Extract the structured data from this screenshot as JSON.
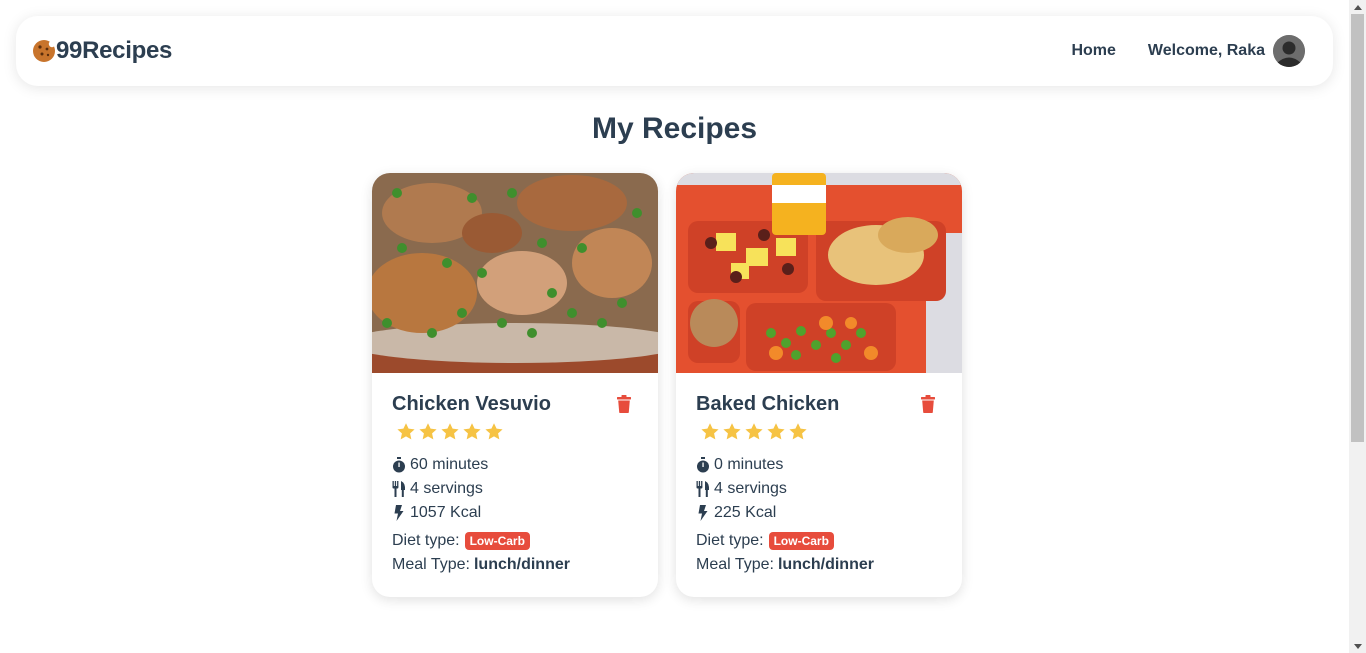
{
  "brand": {
    "name": "99Recipes",
    "icon": "cookie-icon"
  },
  "nav": {
    "home": "Home",
    "welcome": "Welcome, Raka",
    "avatar_icon": "user-avatar-icon"
  },
  "page": {
    "title": "My Recipes"
  },
  "colors": {
    "accent": "#e74c3c",
    "text": "#2c3e50",
    "star": "#f6c344",
    "cookie": "#c8742c"
  },
  "recipes": [
    {
      "title": "Chicken Vesuvio",
      "rating": 5,
      "time": "60 minutes",
      "servings": "4 servings",
      "calories": "1057 Kcal",
      "diet_label": "Diet type:",
      "diet": "Low-Carb",
      "meal_label": "Meal Type:",
      "meal": "lunch/dinner",
      "image": "chicken-vesuvio-photo"
    },
    {
      "title": "Baked Chicken",
      "rating": 5,
      "time": "0 minutes",
      "servings": "4 servings",
      "calories": "225 Kcal",
      "diet_label": "Diet type:",
      "diet": "Low-Carb",
      "meal_label": "Meal Type:",
      "meal": "lunch/dinner",
      "image": "baked-chicken-tray-photo"
    }
  ]
}
